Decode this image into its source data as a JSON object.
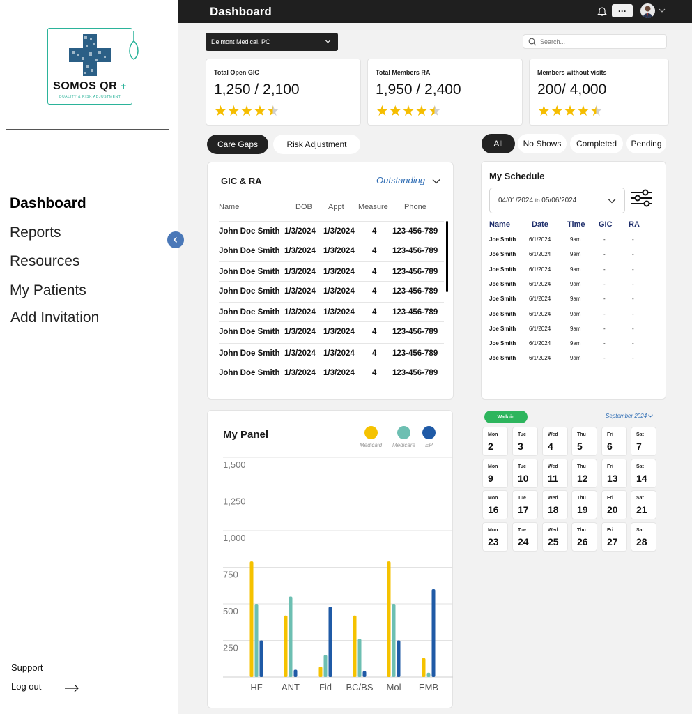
{
  "brand": {
    "name": "SOMOS QR",
    "plus": "+",
    "tagline": "QUALITY & RISK ADJUSTMENT",
    "accent": "#2bb39a"
  },
  "sidebar": {
    "items": [
      {
        "label": "Dashboard",
        "active": true
      },
      {
        "label": "Reports"
      },
      {
        "label": "Resources"
      },
      {
        "label": "My Patients"
      },
      {
        "label": "Add Invitation"
      }
    ],
    "support": "Support",
    "logout": "Log out"
  },
  "topbar": {
    "title": "Dashboard",
    "more": "···"
  },
  "filters": {
    "practice": "Delmont Medical, PC",
    "search_placeholder": "Search..."
  },
  "stats": [
    {
      "label": "Total Open GIC",
      "value": "1,250 / 2,100",
      "rating": 4.5
    },
    {
      "label": "Total Members RA",
      "value": "1,950 / 2,400",
      "rating": 4.5
    },
    {
      "label": "Members without visits",
      "value": "200/ 4,000",
      "rating": 4.5
    }
  ],
  "tabs_left": [
    "Care Gaps",
    "Risk Adjustment"
  ],
  "tabs_right": [
    "All",
    "No Shows",
    "Completed",
    "Pending"
  ],
  "gic": {
    "title": "GIC & RA",
    "filter": "Outstanding",
    "columns": [
      "Name",
      "DOB",
      "Appt",
      "Measure",
      "Phone"
    ],
    "rows": [
      [
        "John Doe Smith",
        "1/3/2024",
        "1/3/2024",
        "4",
        "123-456-789"
      ],
      [
        "John Doe Smith",
        "1/3/2024",
        "1/3/2024",
        "4",
        "123-456-789"
      ],
      [
        "John Doe Smith",
        "1/3/2024",
        "1/3/2024",
        "4",
        "123-456-789"
      ],
      [
        "John Doe Smith",
        "1/3/2024",
        "1/3/2024",
        "4",
        "123-456-789"
      ],
      [
        "John Doe Smith",
        "1/3/2024",
        "1/3/2024",
        "4",
        "123-456-789"
      ],
      [
        "John Doe Smith",
        "1/3/2024",
        "1/3/2024",
        "4",
        "123-456-789"
      ],
      [
        "John Doe Smith",
        "1/3/2024",
        "1/3/2024",
        "4",
        "123-456-789"
      ],
      [
        "John Doe Smith",
        "1/3/2024",
        "1/3/2024",
        "4",
        "123-456-789"
      ]
    ]
  },
  "schedule": {
    "title": "My Schedule",
    "from": "04/01/2024",
    "to_word": "to",
    "to": "05/06/2024",
    "columns": [
      "Name",
      "Date",
      "Time",
      "GIC",
      "RA"
    ],
    "rows": [
      [
        "Joe Smith",
        "6/1/2024",
        "9am",
        "-",
        "-"
      ],
      [
        "Joe Smith",
        "6/1/2024",
        "9am",
        "-",
        "-"
      ],
      [
        "Joe Smith",
        "6/1/2024",
        "9am",
        "-",
        "-"
      ],
      [
        "Joe Smith",
        "6/1/2024",
        "9am",
        "-",
        "-"
      ],
      [
        "Joe Smith",
        "6/1/2024",
        "9am",
        "-",
        "-"
      ],
      [
        "Joe Smith",
        "6/1/2024",
        "9am",
        "-",
        "-"
      ],
      [
        "Joe Smith",
        "6/1/2024",
        "9am",
        "-",
        "-"
      ],
      [
        "Joe Smith",
        "6/1/2024",
        "9am",
        "-",
        "-"
      ],
      [
        "Joe Smith",
        "6/1/2024",
        "9am",
        "-",
        "-"
      ]
    ]
  },
  "calendar": {
    "walkin": "Walk-in",
    "month": "September 2024",
    "weekdays": [
      "Mon",
      "Tue",
      "Wed",
      "Thu",
      "Fri",
      "Sat"
    ],
    "weeks": [
      [
        2,
        3,
        4,
        5,
        6,
        7
      ],
      [
        9,
        10,
        11,
        12,
        13,
        14
      ],
      [
        16,
        17,
        18,
        19,
        20,
        21
      ],
      [
        23,
        24,
        25,
        26,
        27,
        28
      ]
    ]
  },
  "chart_data": {
    "type": "bar",
    "title": "My Panel",
    "categories": [
      "HF",
      "ANT",
      "Fid",
      "BC/BS",
      "Mol",
      "EMB"
    ],
    "series": [
      {
        "name": "Medicaid",
        "color": "#f5c200",
        "values": [
          790,
          420,
          70,
          420,
          790,
          130
        ]
      },
      {
        "name": "Medicare",
        "color": "#6dbfb2",
        "values": [
          500,
          550,
          150,
          260,
          500,
          30
        ]
      },
      {
        "name": "EP",
        "color": "#1f5aa6",
        "values": [
          250,
          50,
          480,
          40,
          250,
          600
        ]
      }
    ],
    "ylim": [
      0,
      1500
    ],
    "yticks": [
      "250",
      "500",
      "750",
      "1,000",
      "1,250",
      "1,500"
    ],
    "ytick_values": [
      250,
      500,
      750,
      1000,
      1250,
      1500
    ],
    "grid": true,
    "legend": "top-right"
  }
}
